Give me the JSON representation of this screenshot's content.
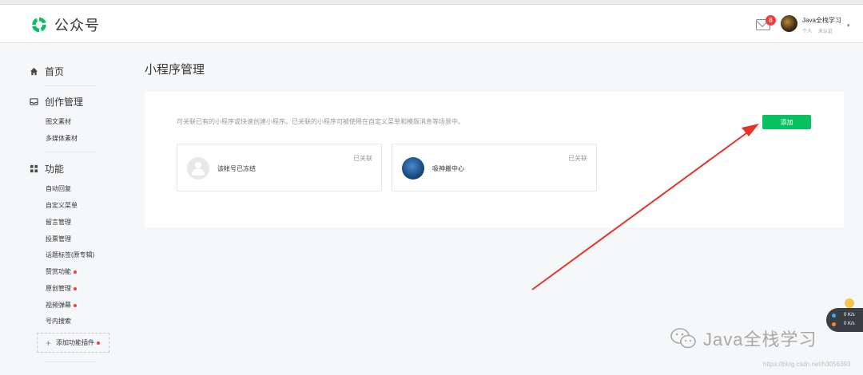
{
  "header": {
    "brand": "公众号",
    "mail_badge": "8",
    "account_name": "Java全栈学习",
    "account_type": "个人",
    "account_verify": "未认证"
  },
  "sidebar": {
    "home": "首页",
    "sections": [
      {
        "title": "创作管理",
        "items": [
          "图文素材",
          "多媒体素材"
        ]
      },
      {
        "title": "功能",
        "items": [
          "自动回复",
          "自定义菜单",
          "留言管理",
          "投票管理",
          "话题标签(原专辑)",
          "赞赏功能",
          "原创管理",
          "视频弹幕",
          "号内搜索"
        ]
      }
    ],
    "add_plugin": "添加功能插件"
  },
  "main": {
    "title": "小程序管理",
    "description": "可关联已有的小程序或快速创建小程序。已关联的小程序可被使用在自定义菜单和模版消息等场景中。",
    "add_button": "添加",
    "apps": [
      {
        "name": "该帐号已冻结",
        "status": "已关联"
      },
      {
        "name": "吸神搬中心",
        "status": "已关联"
      }
    ]
  },
  "watermark": {
    "text": "Java全栈学习",
    "url": "https://blog.csdn.net/h3056393"
  },
  "widget": {
    "up": "0 K/s",
    "down": "0 K/s"
  },
  "colors": {
    "primary": "#07c160",
    "badge": "#e64340",
    "arrow": "#e8322a"
  }
}
